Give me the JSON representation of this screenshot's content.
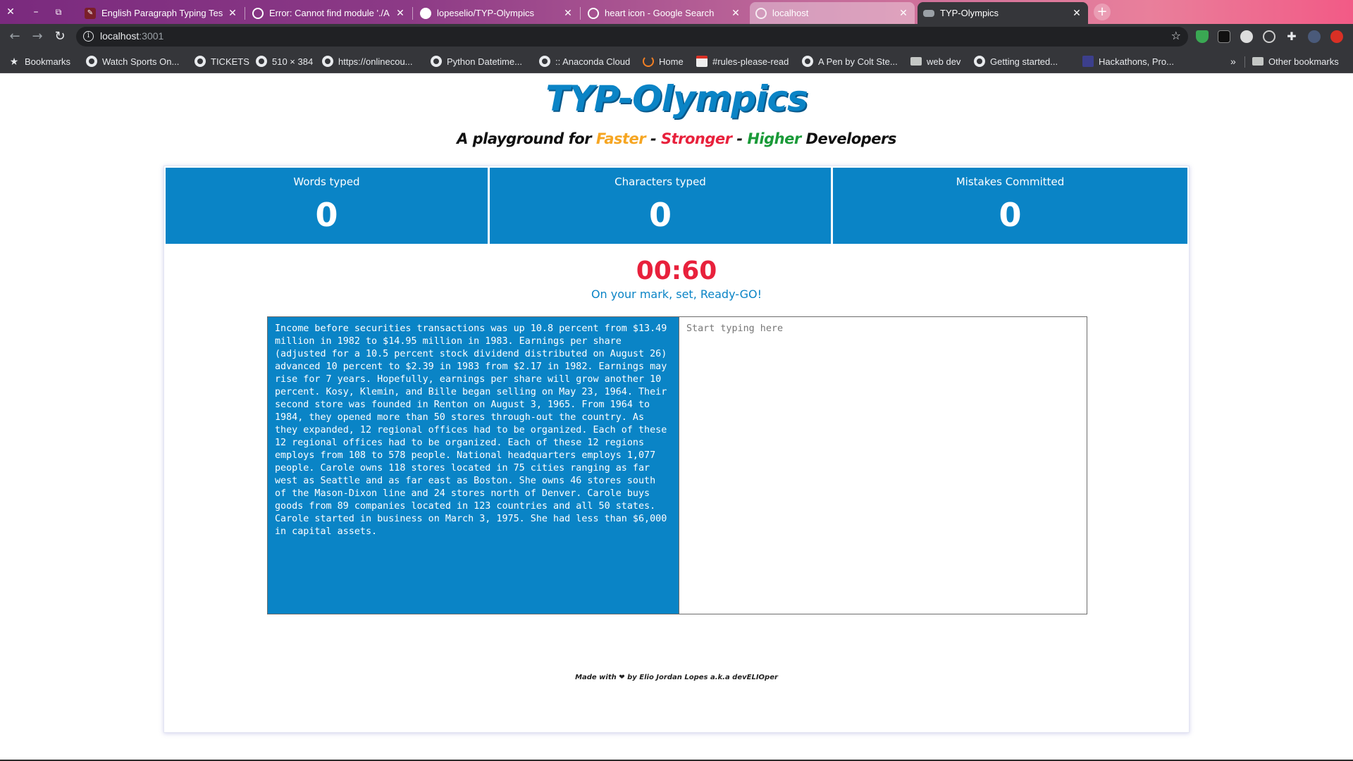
{
  "browser": {
    "tabs": [
      {
        "title": "English Paragraph Typing Tes",
        "icon": "typing-test-favicon"
      },
      {
        "title": "Error: Cannot find module './A",
        "icon": "google-favicon"
      },
      {
        "title": "lopeselio/TYP-Olympics",
        "icon": "github-favicon"
      },
      {
        "title": "heart icon - Google Search",
        "icon": "google-favicon"
      },
      {
        "title": "localhost",
        "icon": "globe-favicon"
      },
      {
        "title": "TYP-Olympics",
        "icon": "typ-favicon"
      }
    ],
    "url_host": "localhost",
    "url_port": ":3001",
    "bookmarks": [
      {
        "label": "Bookmarks",
        "icon": "star"
      },
      {
        "label": "Watch Sports On...",
        "icon": "globe"
      },
      {
        "label": "TICKETS",
        "icon": "globe"
      },
      {
        "label": "510 × 384",
        "icon": "globe"
      },
      {
        "label": "https://onlinecou...",
        "icon": "globe"
      },
      {
        "label": "Python Datetime...",
        "icon": "globe"
      },
      {
        "label": ":: Anaconda Cloud",
        "icon": "globe"
      },
      {
        "label": "Home",
        "icon": "arc"
      },
      {
        "label": "#rules-please-read",
        "icon": "calendar"
      },
      {
        "label": "A Pen by Colt Ste...",
        "icon": "globe"
      },
      {
        "label": "web dev",
        "icon": "folder"
      },
      {
        "label": "Getting started...",
        "icon": "globe"
      },
      {
        "label": "Hackathons, Pro...",
        "icon": "square"
      },
      {
        "label": "»",
        "icon": "none"
      },
      {
        "label": "Other bookmarks",
        "icon": "folder"
      }
    ]
  },
  "app": {
    "title": "TYP-Olympics",
    "tagline": {
      "prefix": "A playground for ",
      "faster": "Faster",
      "sep1": " - ",
      "stronger": "Stronger",
      "sep2": " - ",
      "higher": "Higher",
      "suffix": " Developers"
    },
    "stats": [
      {
        "label": "Words typed",
        "value": "0"
      },
      {
        "label": "Characters typed",
        "value": "0"
      },
      {
        "label": "Mistakes Committed",
        "value": "0"
      }
    ],
    "timer": "00:60",
    "ready_text": "On your mark, set, Ready-GO!",
    "paragraph": "Income before securities transactions was up 10.8 percent from $13.49 million in 1982 to $14.95 million in 1983. Earnings per share (adjusted for a 10.5 percent stock dividend distributed on August 26) advanced 10 percent to $2.39 in 1983 from $2.17 in 1982. Earnings may rise for 7 years. Hopefully, earnings per share will grow another 10 percent. Kosy, Klemin, and Bille began selling on May 23, 1964. Their second store was founded in Renton on August 3, 1965. From 1964 to 1984, they opened more than 50 stores through-out the country. As they expanded, 12 regional offices had to be organized. Each of these 12 regional offices had to be organized. Each of these 12 regions employs from 108 to 578 people. National headquarters employs 1,077 people. Carole owns 118 stores located in 75 cities ranging as far west as Seattle and as far east as Boston. She owns 46 stores south of the Mason-Dixon line and 24 stores north of Denver. Carole buys goods from 89 companies located in 123 countries and all 50 states. Carole started in business on March 3, 1975. She had less than $6,000 in capital assets.",
    "input_placeholder": "Start typing here",
    "input_value": "",
    "footer": {
      "prefix": "Made with ",
      "heart": "❤",
      "suffix": " by Elio Jordan Lopes a.k.a devELIOper"
    }
  },
  "colors": {
    "accent": "#0a84c6",
    "timer": "#e8213c",
    "faster": "#f6a623",
    "stronger": "#e8213c",
    "higher": "#1a9a38"
  }
}
